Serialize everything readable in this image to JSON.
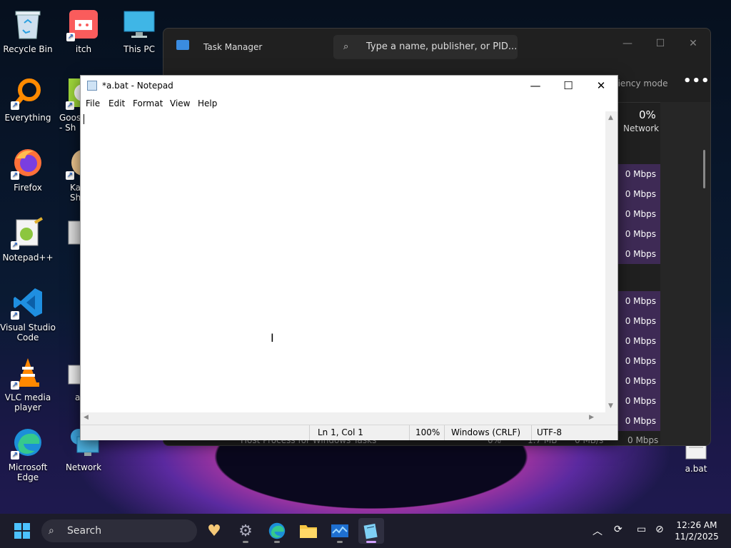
{
  "desktop": {
    "icons": [
      {
        "label": "Recycle Bin"
      },
      {
        "label": "itch"
      },
      {
        "label": "This PC"
      },
      {
        "label": "Everything"
      },
      {
        "label": "Goos\n- Sh"
      },
      {
        "label": "Firefox"
      },
      {
        "label": "Ka\nSh"
      },
      {
        "label": "Notepad++"
      },
      {
        "label": "Visual Studio Code"
      },
      {
        "label": "VLC media player"
      },
      {
        "label": "a"
      },
      {
        "label": "Microsoft Edge"
      },
      {
        "label": "Network"
      },
      {
        "label": "a.bat"
      }
    ]
  },
  "task_manager": {
    "title": "Task Manager",
    "search_placeholder": "Type a name, publisher, or PID...",
    "efficiency_mode": "ciency mode",
    "more": "•••",
    "network_percent": "0%",
    "network_label": "Network",
    "network_values": [
      "0 Mbps",
      "0 Mbps",
      "0 Mbps",
      "0 Mbps",
      "0 Mbps",
      "0 Mbps",
      "0 Mbps",
      "0 Mbps",
      "0 Mbps",
      "0 Mbps",
      "0 Mbps",
      "0 Mbps"
    ],
    "bottom_row": {
      "name": "Host Process for Windows Tasks",
      "cpu": "0%",
      "mem": "1.7 MB",
      "disk": "0 MB/s",
      "net": "0 Mbps"
    }
  },
  "notepad": {
    "title": "*a.bat - Notepad",
    "menu": [
      "File",
      "Edit",
      "Format",
      "View",
      "Help"
    ],
    "content": "",
    "status": {
      "position": "Ln 1, Col 1",
      "zoom": "100%",
      "line_ending": "Windows (CRLF)",
      "encoding": "UTF-8"
    }
  },
  "taskbar": {
    "search_label": "Search",
    "clock_time": "12:26 AM",
    "clock_date": "11/2/2025"
  }
}
